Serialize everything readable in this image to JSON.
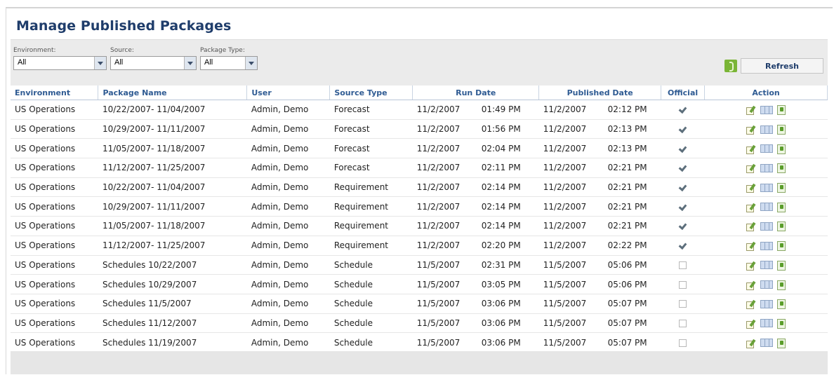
{
  "title": "Manage Published Packages",
  "filters": [
    {
      "label": "Environment:",
      "value": "All"
    },
    {
      "label": "Source:",
      "value": "All"
    },
    {
      "label": "Package Type:",
      "value": "All"
    }
  ],
  "refresh_label": "Refresh",
  "columns": [
    "Environment",
    "Package Name",
    "User",
    "Source Type",
    "Run Date",
    "Published Date",
    "Official",
    "Action"
  ],
  "rows": [
    {
      "env": "US Operations",
      "pkg": "10/22/2007- 11/04/2007",
      "user": "Admin, Demo",
      "src": "Forecast",
      "run_date": "11/2/2007",
      "run_time": "01:49 PM",
      "pub_date": "11/2/2007",
      "pub_time": "02:12 PM",
      "official": true
    },
    {
      "env": "US Operations",
      "pkg": "10/29/2007- 11/11/2007",
      "user": "Admin, Demo",
      "src": "Forecast",
      "run_date": "11/2/2007",
      "run_time": "01:56 PM",
      "pub_date": "11/2/2007",
      "pub_time": "02:13 PM",
      "official": true
    },
    {
      "env": "US Operations",
      "pkg": "11/05/2007- 11/18/2007",
      "user": "Admin, Demo",
      "src": "Forecast",
      "run_date": "11/2/2007",
      "run_time": "02:04 PM",
      "pub_date": "11/2/2007",
      "pub_time": "02:13 PM",
      "official": true
    },
    {
      "env": "US Operations",
      "pkg": "11/12/2007- 11/25/2007",
      "user": "Admin, Demo",
      "src": "Forecast",
      "run_date": "11/2/2007",
      "run_time": "02:11 PM",
      "pub_date": "11/2/2007",
      "pub_time": "02:21 PM",
      "official": true
    },
    {
      "env": "US Operations",
      "pkg": "10/22/2007- 11/04/2007",
      "user": "Admin, Demo",
      "src": "Requirement",
      "run_date": "11/2/2007",
      "run_time": "02:14 PM",
      "pub_date": "11/2/2007",
      "pub_time": "02:21 PM",
      "official": true
    },
    {
      "env": "US Operations",
      "pkg": "10/29/2007- 11/11/2007",
      "user": "Admin, Demo",
      "src": "Requirement",
      "run_date": "11/2/2007",
      "run_time": "02:14 PM",
      "pub_date": "11/2/2007",
      "pub_time": "02:21 PM",
      "official": true
    },
    {
      "env": "US Operations",
      "pkg": "11/05/2007- 11/18/2007",
      "user": "Admin, Demo",
      "src": "Requirement",
      "run_date": "11/2/2007",
      "run_time": "02:14 PM",
      "pub_date": "11/2/2007",
      "pub_time": "02:21 PM",
      "official": true
    },
    {
      "env": "US Operations",
      "pkg": "11/12/2007- 11/25/2007",
      "user": "Admin, Demo",
      "src": "Requirement",
      "run_date": "11/2/2007",
      "run_time": "02:20 PM",
      "pub_date": "11/2/2007",
      "pub_time": "02:22 PM",
      "official": true
    },
    {
      "env": "US Operations",
      "pkg": "Schedules 10/22/2007",
      "user": "Admin, Demo",
      "src": "Schedule",
      "run_date": "11/5/2007",
      "run_time": "02:31 PM",
      "pub_date": "11/5/2007",
      "pub_time": "05:06 PM",
      "official": false
    },
    {
      "env": "US Operations",
      "pkg": "Schedules 10/29/2007",
      "user": "Admin, Demo",
      "src": "Schedule",
      "run_date": "11/5/2007",
      "run_time": "03:05 PM",
      "pub_date": "11/5/2007",
      "pub_time": "05:06 PM",
      "official": false
    },
    {
      "env": "US Operations",
      "pkg": "Schedules 11/5/2007",
      "user": "Admin, Demo",
      "src": "Schedule",
      "run_date": "11/5/2007",
      "run_time": "03:06 PM",
      "pub_date": "11/5/2007",
      "pub_time": "05:07 PM",
      "official": false
    },
    {
      "env": "US Operations",
      "pkg": "Schedules 11/12/2007",
      "user": "Admin, Demo",
      "src": "Schedule",
      "run_date": "11/5/2007",
      "run_time": "03:06 PM",
      "pub_date": "11/5/2007",
      "pub_time": "05:07 PM",
      "official": false
    },
    {
      "env": "US Operations",
      "pkg": "Schedules 11/19/2007",
      "user": "Admin, Demo",
      "src": "Schedule",
      "run_date": "11/5/2007",
      "run_time": "03:06 PM",
      "pub_date": "11/5/2007",
      "pub_time": "05:07 PM",
      "official": false
    }
  ],
  "action_icons": [
    "edit-icon",
    "view-grid-icon",
    "export-doc-icon"
  ],
  "colors": {
    "title": "#1f3d6b",
    "header_text": "#2f5b93",
    "filterbar_bg": "#ebebeb"
  }
}
